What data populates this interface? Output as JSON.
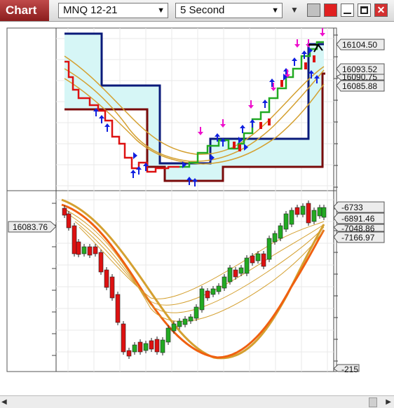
{
  "window": {
    "tab_label": "Chart",
    "instrument": "MNQ 12-21",
    "interval": "5 Second",
    "close_glyph": "✕"
  },
  "price_panel": {
    "tags": [
      {
        "label": "16104.50",
        "color": "#000000"
      },
      {
        "label": "16093.52",
        "color": "#000000"
      },
      {
        "label": "16090.75",
        "color": "#000000"
      },
      {
        "label": "16085.88",
        "color": "#000000"
      }
    ]
  },
  "indicator_panel": {
    "left_tag": "16083.76",
    "tags": [
      "-6733",
      "-6891.46",
      "-7048.86",
      "-7166.97"
    ],
    "bottom_tag": "-215"
  },
  "colors": {
    "up": "#22aa22",
    "down": "#dd1111",
    "channel_upper": "#0a1a7a",
    "channel_lower": "#7a0a0a",
    "fill": "#d6f6f6",
    "ma_gold": "#d4a030",
    "ma_orange": "#f06010",
    "arrow_blue": "#1020e0",
    "arrow_magenta": "#ee10cc"
  },
  "icons": [
    "dropdown-arrow-icon",
    "menu-arrow-icon",
    "gray-square-icon",
    "red-square-icon",
    "minimize-icon",
    "maximize-icon",
    "close-icon",
    "scroll-left-icon",
    "scroll-right-icon"
  ]
}
